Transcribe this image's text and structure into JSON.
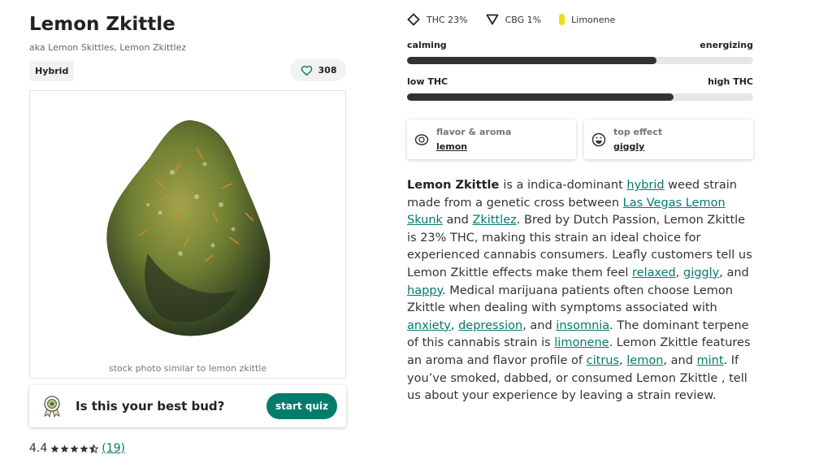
{
  "strain": {
    "name": "Lemon Zkittle",
    "aka": "aka Lemon Skittles, Lemon Zkittlez",
    "type_badge": "Hybrid",
    "likes": "308",
    "photo_caption": "stock photo similar to lemon zkittle"
  },
  "quiz": {
    "prompt": "Is this your best bud?",
    "button": "start quiz"
  },
  "rating": {
    "score": "4.4",
    "stars": 4.4,
    "count": "(19)"
  },
  "chemicals": [
    {
      "label": "THC 23%",
      "icon": "diamond-icon"
    },
    {
      "label": "CBG 1%",
      "icon": "triangle-icon"
    },
    {
      "label": "Limonene",
      "icon": "limonene-dot-icon",
      "color": "#eadf0c"
    }
  ],
  "sliders": [
    {
      "left_label": "calming",
      "right_label": "energizing",
      "value": 0.72
    },
    {
      "left_label": "low THC",
      "right_label": "high THC",
      "value": 0.77
    }
  ],
  "cards": [
    {
      "label": "flavor & aroma",
      "value": "lemon",
      "icon": "lemon-slice-icon"
    },
    {
      "label": "top effect",
      "value": "giggly",
      "icon": "laughing-face-icon"
    }
  ],
  "description": {
    "p1": "Lemon Zkittle ",
    "t1": " is a indica-dominant ",
    "l1": "hybrid",
    "t2": " weed strain made from a genetic cross between ",
    "l2": "Las Vegas Lemon Skunk",
    "t3": " and ",
    "l3": "Zkittlez",
    "t4": ". Bred by Dutch Passion, Lemon Zkittle is 23% THC, making this strain an ideal choice for experienced cannabis consumers. Leafly customers tell us Lemon Zkittle  effects make them feel ",
    "l4": "relaxed",
    "t5": ",  ",
    "l5": "giggly",
    "t6": ", and ",
    "l6": "happy",
    "t7": ". Medical marijuana patients often choose Lemon Zkittle  when dealing with symptoms associated with ",
    "l7": "anxiety",
    "t8": ", ",
    "l8": "depression",
    "t9": ", and ",
    "l9": "insomnia",
    "t10": ". The dominant terpene of this cannabis strain is ",
    "l10": "limonene",
    "t11": ". Lemon Zkittle  features an aroma and flavor profile of ",
    "l11": "citrus",
    "t12": ", ",
    "l12": "lemon",
    "t13": ", and ",
    "l13": "mint",
    "t14": ". If you’ve smoked, dabbed, or consumed Lemon Zkittle , tell us about your experience by leaving a strain review."
  },
  "colors": {
    "accent": "#017c6b",
    "bar_fill": "#333333",
    "bar_track": "#e6e6e6"
  }
}
